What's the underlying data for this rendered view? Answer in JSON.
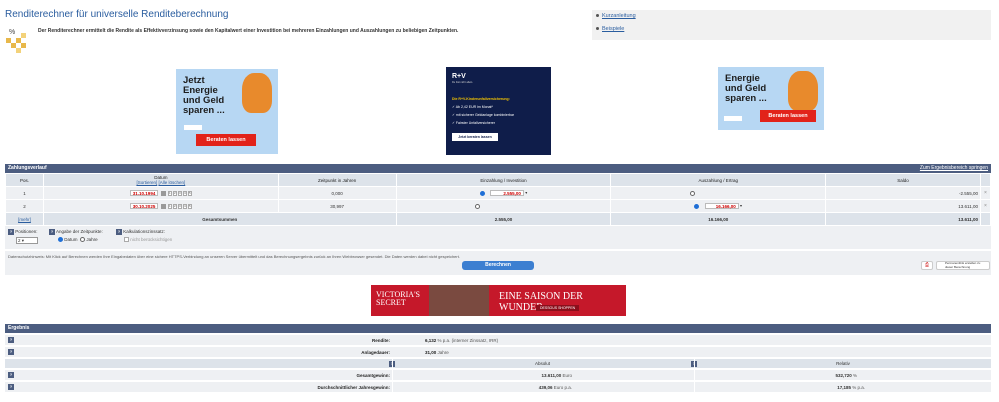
{
  "header": {
    "title": "Renditerechner für universelle Renditeberechnung",
    "subtitle": "Der Renditerechner ermittelt die Rendite als Effektivverzinsung sowie den Kapitalwert einer Investition bei mehreren Einzahlungen und Auszahlungen zu beliebigen Zeitpunkten.",
    "logo_symbol": "%"
  },
  "side_links": [
    {
      "label": "Kurzanleitung"
    },
    {
      "label": "Beispiele"
    }
  ],
  "ads": {
    "energie_text": "Jetzt Energie und Geld sparen ...",
    "energie_button": "Beraten lassen",
    "energie2_text": "Energie und Geld sparen ...",
    "energie2_button": "Beraten lassen",
    "rv_brand": "R+V",
    "rv_slogan": "Du bist nicht allein.",
    "rv_head": "Die R+V-Kinderunfallversicherung:",
    "rv_items": [
      "Ab 2,42 EUR im Monat*",
      "mit sicherer Geldanlage kombinierbar",
      "Fairster Unfallversicherer"
    ],
    "rv_button": "Jetzt beraten lassen",
    "vs_left": "VICTORIA'S SECRET",
    "vs_right": "EINE SAISON DER WUNDER",
    "vs_button": "DESSOUS SHOPPEN"
  },
  "payments": {
    "section_title": "Zahlungsverlauf",
    "jump_link": "Zum Ergebnisbereich springen",
    "columns": {
      "pos": "Pos.",
      "datum": "Datum",
      "sort_link": "[Sortieren]",
      "clear_link": "[Alle löschen]",
      "zeitpunkt": "Zeitpunkt in Jahren",
      "einzahlung": "Einzahlung / Investition",
      "auszahlung": "Auszahlung / Ertrag",
      "saldo": "Saldo"
    },
    "rows": [
      {
        "pos": "1",
        "date": "31.10.1994",
        "zeitpunkt": "0,000",
        "einzahlung": "2.555,00",
        "auszahlung": "",
        "saldo": "-2.555,00"
      },
      {
        "pos": "2",
        "date": "30.10.2025",
        "zeitpunkt": "30,997",
        "einzahlung": "",
        "auszahlung": "16.166,00",
        "saldo": "13.611,00"
      }
    ],
    "sum_row": {
      "more_link": "[mehr]",
      "label": "Gesamtsummen",
      "einzahlung": "2.555,00",
      "auszahlung": "16.166,00",
      "saldo": "13.611,00"
    },
    "date_tools": [
      "1",
      "2",
      "3",
      "4",
      "5"
    ]
  },
  "options": {
    "positions_label": "Positionen:",
    "positions_value": "2",
    "zeitpunkt_label": "Angabe der Zeitpunkte:",
    "zeitpunkt_options": [
      "Datum",
      "Jahre"
    ],
    "kalk_label": "Kalkulationszinssatz:",
    "kalk_check": "nicht berücksichtigen"
  },
  "privacy_text": "Datenschutzhinweis: Mit Klick auf Berechnen werden Ihre Eingabedaten über eine sichere HTTPS-Verbindung an unseren Server übermittelt und das Berechnungsergebnis zurück an Ihren Webbrowser gesendet. Die Daten werden dabei nicht gespeichert.",
  "calc_button": "Berechnen",
  "mini_tools_text": "Permanentlink erstellen zu dieser Berechnung",
  "results": {
    "section_title": "Ergebnis",
    "rendite_label": "Rendite:",
    "rendite_value": "6,132",
    "rendite_unit": "% p.a.",
    "rendite_note": "(interner Zinssatz, IRR)",
    "anlagedauer_label": "Anlagedauer:",
    "anlagedauer_value": "31,00",
    "anlagedauer_unit": "Jahre",
    "absolut": "Absolut",
    "relativ": "Relativ",
    "gesamtgewinn_label": "Gesamtgewinn:",
    "gesamtgewinn_abs": "13.611,00",
    "gesamtgewinn_abs_unit": "Euro",
    "gesamtgewinn_rel": "532,720",
    "gesamtgewinn_rel_unit": "%",
    "jahresgewinn_label": "Durchschnittlicher Jahresgewinn:",
    "jahresgewinn_abs": "439,06",
    "jahresgewinn_abs_unit": "Euro p.a.",
    "jahresgewinn_rel": "17,185",
    "jahresgewinn_rel_unit": "% p.a."
  },
  "colors": {
    "accent": "#2a5d9f",
    "bar": "#4c5d80",
    "button": "#3c7fd1"
  }
}
